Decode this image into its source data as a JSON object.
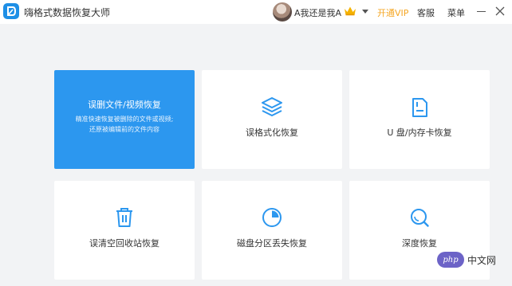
{
  "titlebar": {
    "app_title": "嗨格式数据恢复大师",
    "logo_icon": "app-logo-icon",
    "username": "A我还是我A",
    "vip_label": "开通VIP",
    "service_label": "客服",
    "menu_label": "菜单"
  },
  "tiles": [
    {
      "label": "误删文件/视频恢复",
      "desc_line1": "精准快速恢复被删除的文件或视频;",
      "desc_line2": "还原被编辑前的文件内容",
      "selected": true
    },
    {
      "label": "误格式化恢复",
      "icon": "layers-icon"
    },
    {
      "label": "U 盘/内存卡恢复",
      "icon": "sd-card-icon"
    },
    {
      "label": "误清空回收站恢复",
      "icon": "trash-icon"
    },
    {
      "label": "磁盘分区丢失恢复",
      "icon": "pie-chart-icon"
    },
    {
      "label": "深度恢复",
      "icon": "magnifier-icon"
    }
  ],
  "watermark": {
    "badge": "php",
    "text": "中文网"
  },
  "colors": {
    "accent": "#2c97ef",
    "vip": "#f5a623",
    "background": "#f2f3f5"
  }
}
